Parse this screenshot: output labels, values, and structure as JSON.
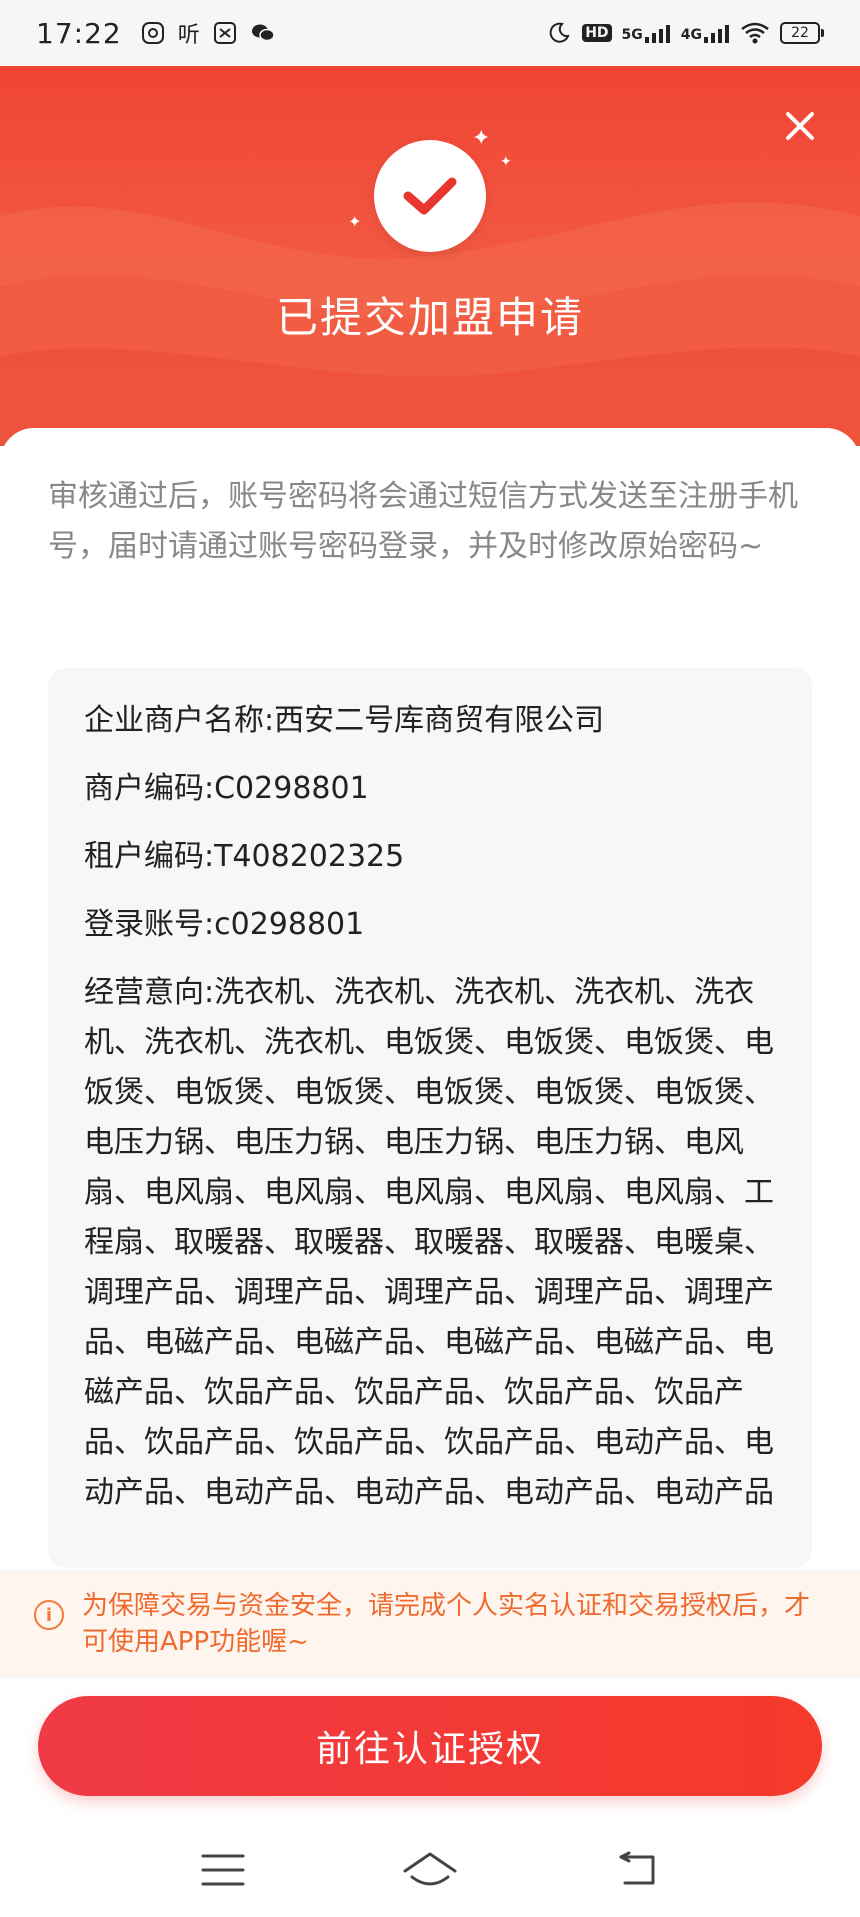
{
  "status_bar": {
    "time": "17:22",
    "listen_label": "听",
    "network_5g": "5G",
    "network_4g": "4G",
    "hd_label": "HD",
    "battery": "22"
  },
  "header": {
    "title": "已提交加盟申请"
  },
  "intro_text": "审核通过后，账号密码将会通过短信方式发送至注册手机号，届时请通过账号密码登录，并及时修改原始密码~",
  "info": {
    "company": "企业商户名称:西安二号库商贸有限公司",
    "merchant_code": "商户编码:C0298801",
    "tenant_code": "租户编码:T408202325",
    "login_account": "登录账号:c0298801",
    "business_intent": "经营意向:洗衣机、洗衣机、洗衣机、洗衣机、洗衣机、洗衣机、洗衣机、电饭煲、电饭煲、电饭煲、电饭煲、电饭煲、电饭煲、电饭煲、电饭煲、电饭煲、电压力锅、电压力锅、电压力锅、电压力锅、电风扇、电风扇、电风扇、电风扇、电风扇、电风扇、工程扇、取暖器、取暖器、取暖器、取暖器、电暖桌、调理产品、调理产品、调理产品、调理产品、调理产品、电磁产品、电磁产品、电磁产品、电磁产品、电磁产品、饮品产品、饮品产品、饮品产品、饮品产品、饮品产品、饮品产品、饮品产品、电动产品、电动产品、电动产品、电动产品、电动产品、电动产品"
  },
  "notice": {
    "text": "为保障交易与资金安全，请完成个人实名认证和交易授权后，才可使用APP功能喔~"
  },
  "primary_button": {
    "label": "前往认证授权"
  },
  "colors": {
    "brand_red": "#f03a3a",
    "notice_orange": "#f06a2e",
    "notice_bg": "#fff5ef"
  }
}
